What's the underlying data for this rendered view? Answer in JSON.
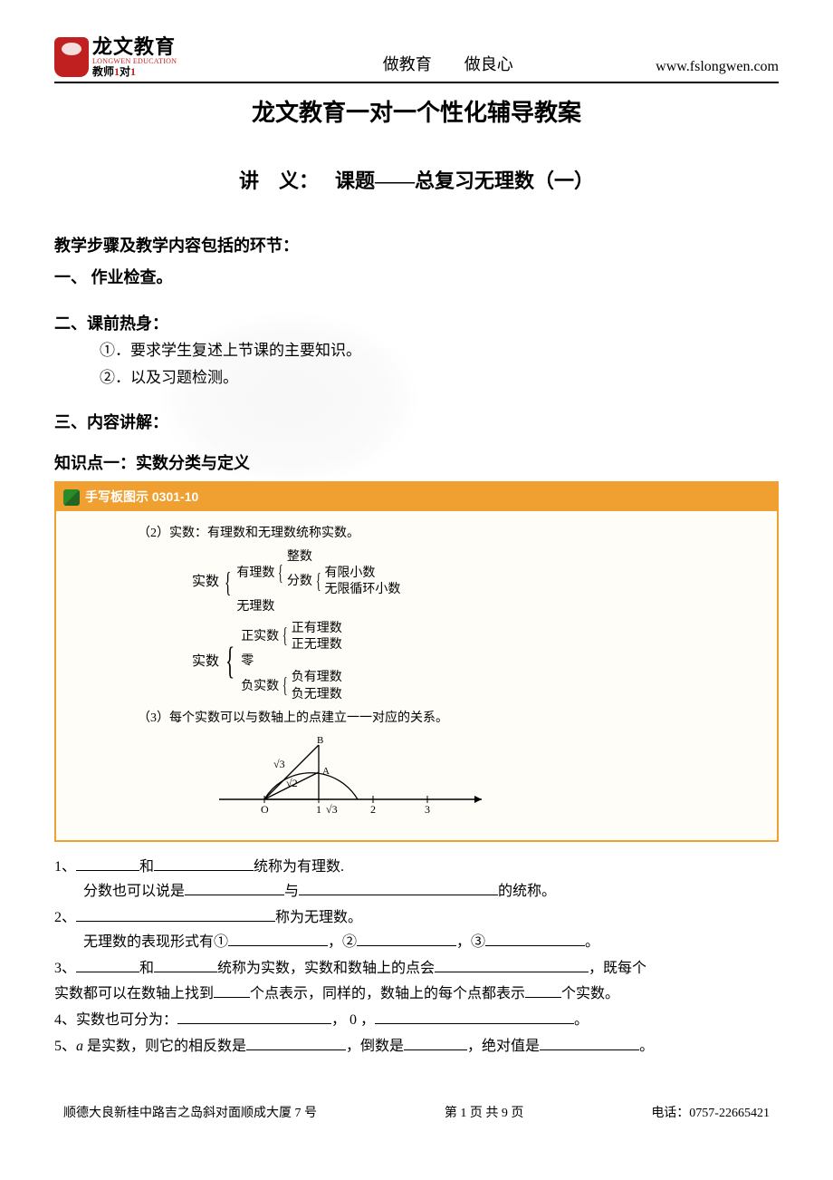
{
  "header": {
    "brand": "龙文教育",
    "brand_en": "LONGWEN EDUCATION",
    "tagline_a": "教师",
    "tagline_b": "1",
    "tagline_c": "对",
    "tagline_d": "1",
    "slogan_a": "做教育",
    "slogan_b": "做良心",
    "url": "www.fslongwen.com"
  },
  "title": "龙文教育一对一个性化辅导教案",
  "subtitle": {
    "lead": "讲　义：",
    "body": "课题——总复习无理数（一）"
  },
  "sections": {
    "steps_head": "教学步骤及教学内容包括的环节：",
    "one": "一、  作业检查。",
    "two_head": "二、课前热身：",
    "two_1": "①．要求学生复述上节课的主要知识。",
    "two_2": "②．以及习题检测。",
    "three_head": "三、内容讲解：",
    "kp1": "知识点一：实数分类与定义"
  },
  "diagram": {
    "header_label": "手写板图示 0301-10",
    "line2": "（2）实数：有理数和无理数统称实数。",
    "struct1": {
      "root": "实数",
      "a": "有理数",
      "b": "无理数",
      "a1": "整数",
      "a2": "分数",
      "a2a": "有限小数",
      "a2b": "无限循环小数"
    },
    "struct2": {
      "root": "实数",
      "a": "正实数",
      "b": "零",
      "c": "负实数",
      "a1": "正有理数",
      "a2": "正无理数",
      "c1": "负有理数",
      "c2": "负无理数"
    },
    "line3": "（3）每个实数可以与数轴上的点建立一一对应的关系。",
    "axis": {
      "O": "O",
      "1": "1",
      "2": "2",
      "3": "3",
      "rt3": "√3",
      "rt2": "√2",
      "B": "B",
      "A": "A"
    }
  },
  "questions": {
    "q1a": "1、",
    "q1b": "和",
    "q1c": "统称为有理数.",
    "q1d": "分数也可以说是",
    "q1e": "与",
    "q1f": "的统称。",
    "q2a": "2、",
    "q2b": "称为无理数。",
    "q2c": "无理数的表现形式有①",
    "q2d": "，②",
    "q2e": "，③",
    "q2f": "。",
    "q3a": "3、",
    "q3b": "和",
    "q3c": "统称为实数，实数和数轴上的点会",
    "q3d": "，既每个",
    "q3e": "实数都可以在数轴上找到",
    "q3f": "个点表示，同样的，数轴上的每个点都表示",
    "q3g": "个实数。",
    "q4a": "4、实数也可分为：",
    "q4b": "， 0 ，",
    "q4c": "。",
    "q5a": "5、",
    "q5var": "a",
    "q5b": " 是实数，则它的相反数是",
    "q5c": "，倒数是",
    "q5d": "，绝对值是",
    "q5e": "。"
  },
  "footer": {
    "address": "顺德大良新桂中路吉之岛斜对面顺成大厦 7 号",
    "page": "第 1 页 共 9 页",
    "phone": "电话：0757-22665421"
  }
}
